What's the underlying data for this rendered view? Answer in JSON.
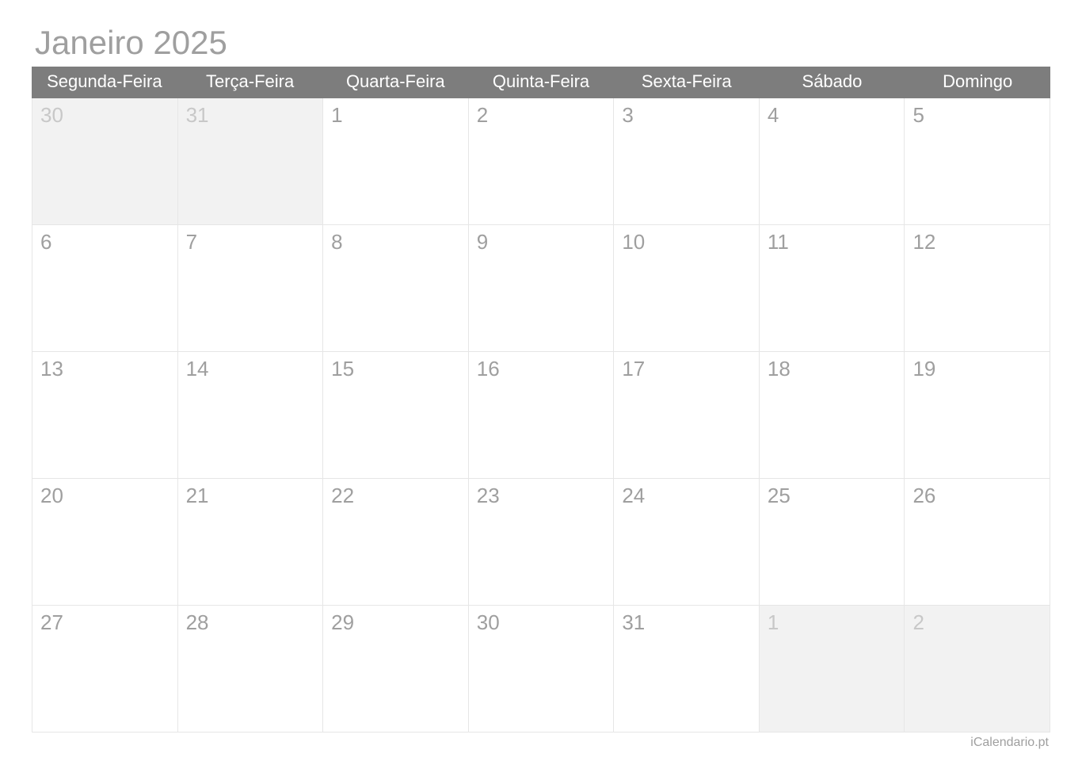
{
  "title": "Janeiro 2025",
  "footer": "iCalendario.pt",
  "weekdays": [
    "Segunda-Feira",
    "Terça-Feira",
    "Quarta-Feira",
    "Quinta-Feira",
    "Sexta-Feira",
    "Sábado",
    "Domingo"
  ],
  "weeks": [
    [
      {
        "day": "30",
        "other": true
      },
      {
        "day": "31",
        "other": true
      },
      {
        "day": "1",
        "other": false
      },
      {
        "day": "2",
        "other": false
      },
      {
        "day": "3",
        "other": false
      },
      {
        "day": "4",
        "other": false
      },
      {
        "day": "5",
        "other": false
      }
    ],
    [
      {
        "day": "6",
        "other": false
      },
      {
        "day": "7",
        "other": false
      },
      {
        "day": "8",
        "other": false
      },
      {
        "day": "9",
        "other": false
      },
      {
        "day": "10",
        "other": false
      },
      {
        "day": "11",
        "other": false
      },
      {
        "day": "12",
        "other": false
      }
    ],
    [
      {
        "day": "13",
        "other": false
      },
      {
        "day": "14",
        "other": false
      },
      {
        "day": "15",
        "other": false
      },
      {
        "day": "16",
        "other": false
      },
      {
        "day": "17",
        "other": false
      },
      {
        "day": "18",
        "other": false
      },
      {
        "day": "19",
        "other": false
      }
    ],
    [
      {
        "day": "20",
        "other": false
      },
      {
        "day": "21",
        "other": false
      },
      {
        "day": "22",
        "other": false
      },
      {
        "day": "23",
        "other": false
      },
      {
        "day": "24",
        "other": false
      },
      {
        "day": "25",
        "other": false
      },
      {
        "day": "26",
        "other": false
      }
    ],
    [
      {
        "day": "27",
        "other": false
      },
      {
        "day": "28",
        "other": false
      },
      {
        "day": "29",
        "other": false
      },
      {
        "day": "30",
        "other": false
      },
      {
        "day": "31",
        "other": false
      },
      {
        "day": "1",
        "other": true
      },
      {
        "day": "2",
        "other": true
      }
    ]
  ]
}
